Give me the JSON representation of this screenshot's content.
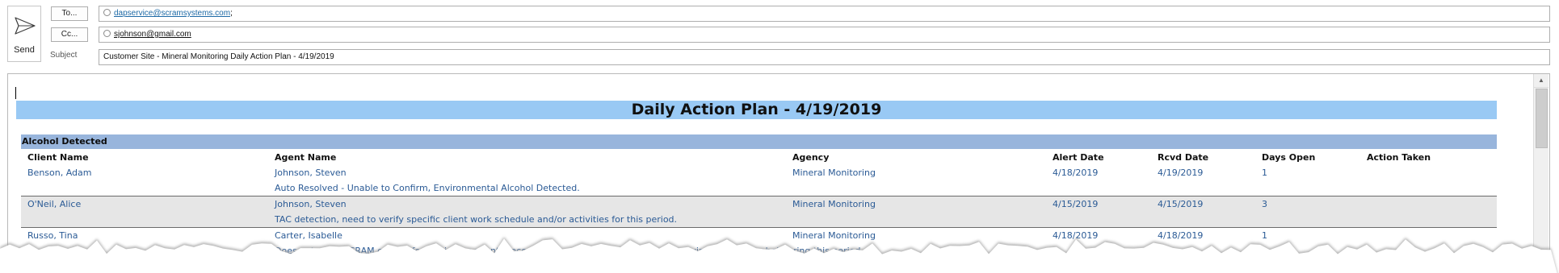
{
  "header": {
    "send_label": "Send",
    "to_button": "To...",
    "cc_button": "Cc...",
    "subject_label": "Subject",
    "to_value": "dapservice@scramsystems.com",
    "to_separator": ";",
    "cc_value": "sjohnson@gmail.com",
    "subject_value": "Customer Site - Mineral Monitoring Daily Action Plan - 4/19/2019"
  },
  "report": {
    "title": "Daily Action Plan - 4/19/2019",
    "section": "Alcohol Detected",
    "columns": [
      "Client Name",
      "Agent Name",
      "Agency",
      "Alert Date",
      "Rcvd Date",
      "Days Open",
      "Action Taken"
    ],
    "rows": [
      {
        "client": "Benson, Adam",
        "agent": "Johnson, Steven",
        "agency": "Mineral Monitoring",
        "alert_date": "4/18/2019",
        "rcvd_date": "4/19/2019",
        "days_open": "1",
        "note": "Auto Resolved - Unable to Confirm, Environmental Alcohol Detected."
      },
      {
        "client": "O'Neil, Alice",
        "agent": "Johnson, Steven",
        "agency": "Mineral Monitoring",
        "alert_date": "4/15/2019",
        "rcvd_date": "4/15/2019",
        "days_open": "3",
        "note": "TAC detection, need to verify specific client work schedule and/or activities for this period."
      },
      {
        "client": "Russo, Tina",
        "agent": "Carter, Isabelle",
        "agency": "Mineral Monitoring",
        "alert_date": "4/18/2019",
        "rcvd_date": "4/18/2019",
        "days_open": "1",
        "note": "Does not meet SCRAM criteria for a drinking event. Recommend requesting client to avoid environmental alcohol during this period."
      }
    ]
  },
  "colors": {
    "title_bar": "#99c9f4",
    "section_bar": "#98b5dc",
    "cell_text": "#2a5a95",
    "alt_row": "#e6e6e6"
  },
  "icons": {
    "send": "paper-plane-icon",
    "recipient": "recipient-status-icon",
    "scroll_up": "scroll-up-arrow-icon"
  }
}
